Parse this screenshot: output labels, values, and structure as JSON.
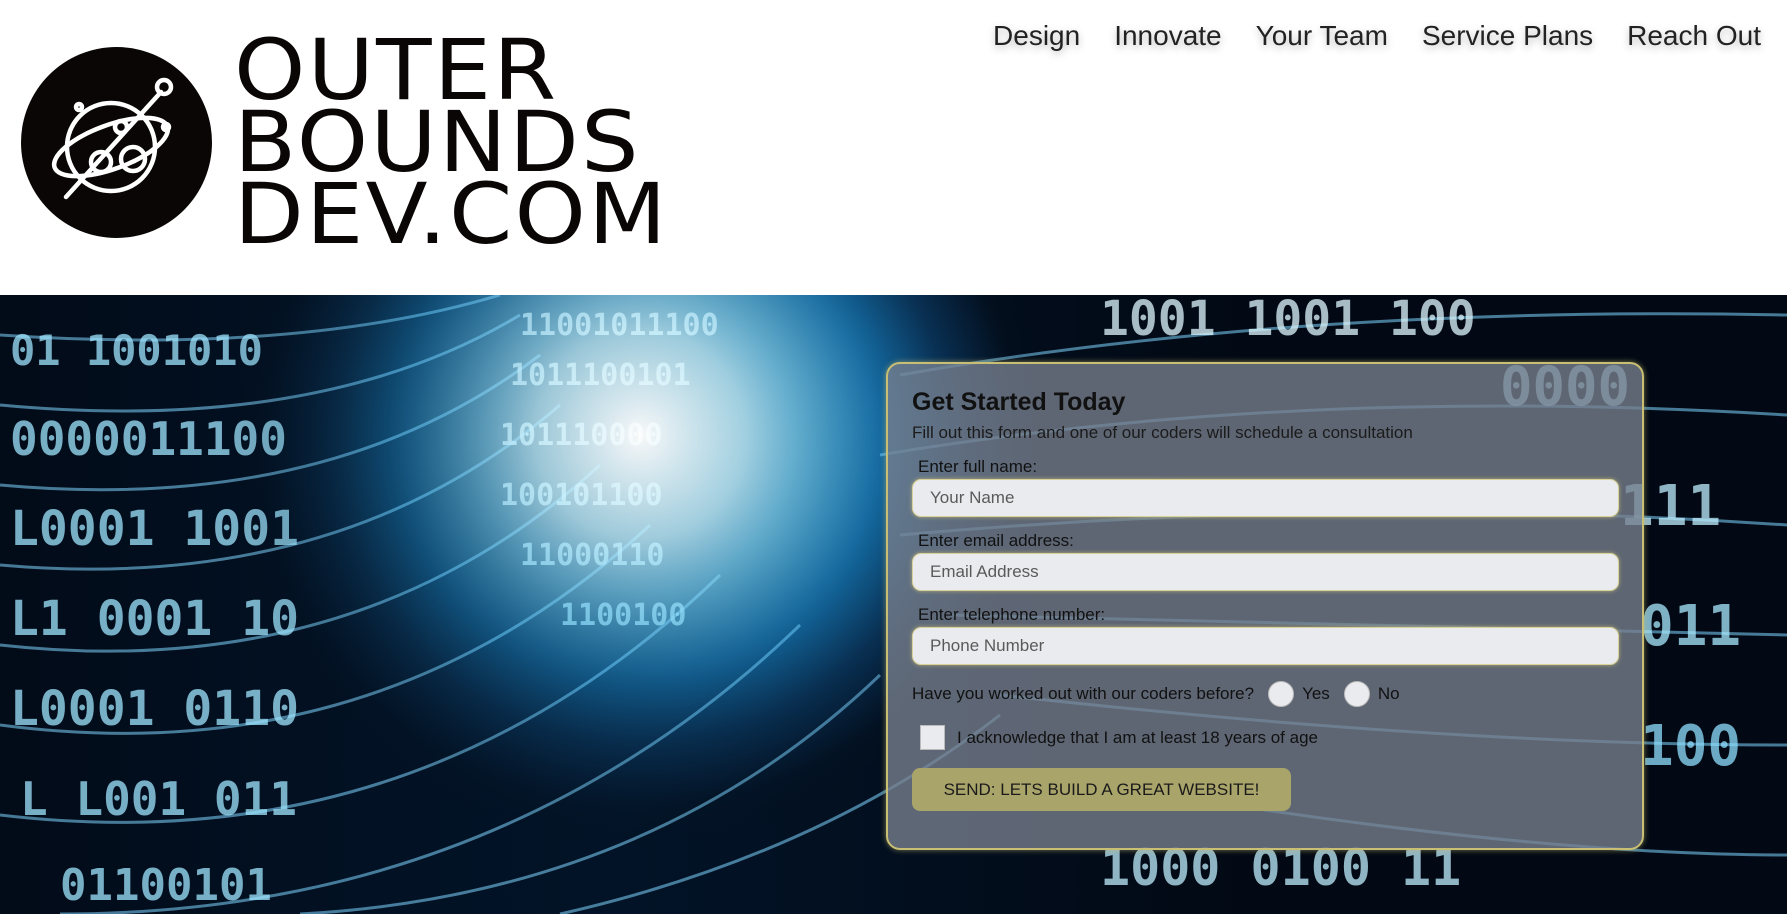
{
  "logo": {
    "line1": "OUTER",
    "line2": "BOUNDS",
    "line3": "DEV.COM",
    "icon": "planet-orbit-icon"
  },
  "nav": {
    "items": [
      {
        "label": "Design"
      },
      {
        "label": "Innovate"
      },
      {
        "label": "Your Team"
      },
      {
        "label": "Service Plans"
      },
      {
        "label": "Reach Out"
      }
    ]
  },
  "hero": {
    "background": "binary-tunnel-image"
  },
  "form": {
    "title": "Get Started Today",
    "subtitle": "Fill out this form and one of our coders will schedule a consultation",
    "name_label": "Enter full name:",
    "name_placeholder": "Your Name",
    "email_label": "Enter email address:",
    "email_placeholder": "Email Address",
    "phone_label": "Enter telephone number:",
    "phone_placeholder": "Phone Number",
    "question": "Have you worked out with our coders before?",
    "radio_yes": "Yes",
    "radio_no": "No",
    "checkbox_label": "I acknowledge that I am at least 18 years of age",
    "submit_label": "SEND: LETS BUILD A GREAT WEBSITE!"
  },
  "colors": {
    "accent_gold": "#a9a46a",
    "card_border": "#c8bf74",
    "logo_black": "#0b0606"
  }
}
